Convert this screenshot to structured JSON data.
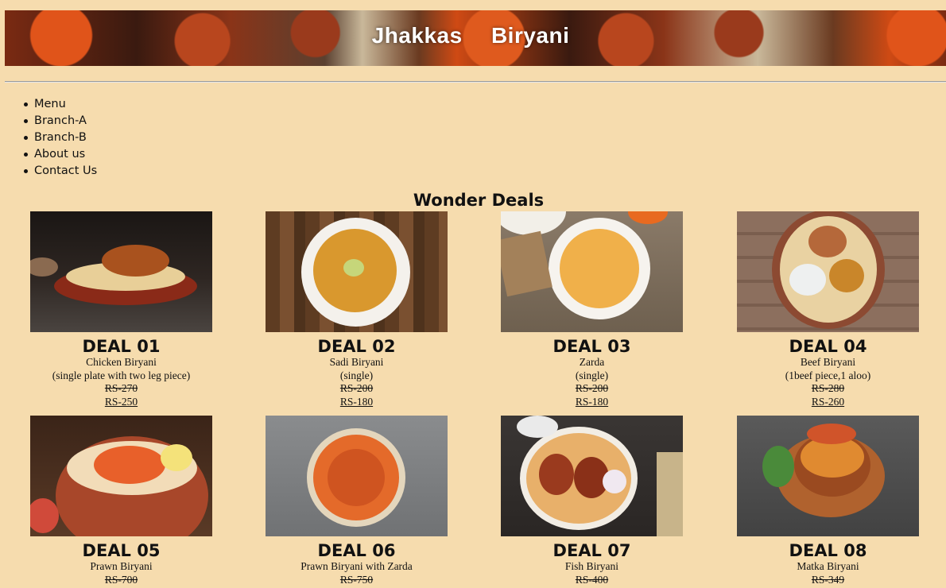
{
  "banner": {
    "title": "Jhakkas    Biryani"
  },
  "nav": [
    "Menu",
    "Branch-A",
    "Branch-B",
    "About us",
    "Contact Us"
  ],
  "section_title": "Wonder Deals",
  "deals": [
    {
      "title": "DEAL 01",
      "name": "Chicken Biryani",
      "detail": "(single plate with two leg piece)",
      "old_price": "RS-270",
      "new_price": "RS-250",
      "image": "chicken-biryani-image"
    },
    {
      "title": "DEAL 02",
      "name": "Sadi Biryani",
      "detail": "(single)",
      "old_price": "RS-200",
      "new_price": "RS-180",
      "image": "sadi-biryani-image"
    },
    {
      "title": "DEAL 03",
      "name": "Zarda",
      "detail": "(single)",
      "old_price": "RS-200",
      "new_price": "RS-180",
      "image": "zarda-image"
    },
    {
      "title": "DEAL 04",
      "name": "Beef Biryani",
      "detail": "(1beef piece,1 aloo)",
      "old_price": "RS-280",
      "new_price": "RS-260",
      "image": "beef-biryani-image"
    },
    {
      "title": "DEAL 05",
      "name": "Prawn Biryani",
      "old_price": "RS-700",
      "image": "prawn-biryani-image"
    },
    {
      "title": "DEAL 06",
      "name": "Prawn Biryani with Zarda",
      "old_price": "RS-750",
      "image": "prawn-biryani-zarda-image"
    },
    {
      "title": "DEAL 07",
      "name": "Fish Biryani",
      "old_price": "RS-400",
      "image": "fish-biryani-image"
    },
    {
      "title": "DEAL 08",
      "name": "Matka Biryani",
      "old_price": "RS-349",
      "image": "matka-biryani-image"
    }
  ]
}
